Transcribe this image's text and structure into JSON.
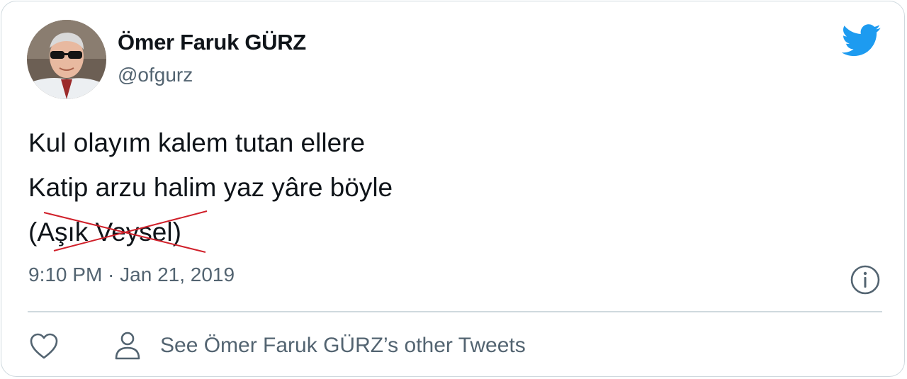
{
  "author": {
    "display_name": "Ömer Faruk GÜRZ",
    "handle": "@ofgurz"
  },
  "tweet": {
    "lines": [
      "Kul olayım kalem tutan ellere",
      "Katip arzu halim yaz yâre böyle"
    ],
    "attribution_open": "(",
    "attribution_name": "Aşık Veysel",
    "attribution_close": ")",
    "timestamp": "9:10 PM · Jan 21, 2019"
  },
  "actions": {
    "other_tweets_label": "See Ömer Faruk GÜRZ’s other Tweets"
  },
  "icons": {
    "brand": "twitter-bird-icon",
    "info": "info-icon",
    "like": "heart-icon",
    "profile": "person-icon",
    "strike": "red-cross-strike"
  },
  "colors": {
    "text_primary": "#0f1419",
    "text_secondary": "#536471",
    "twitter_blue": "#1d9bf0",
    "border": "#cfd9de",
    "strike_red": "#d0202a"
  }
}
